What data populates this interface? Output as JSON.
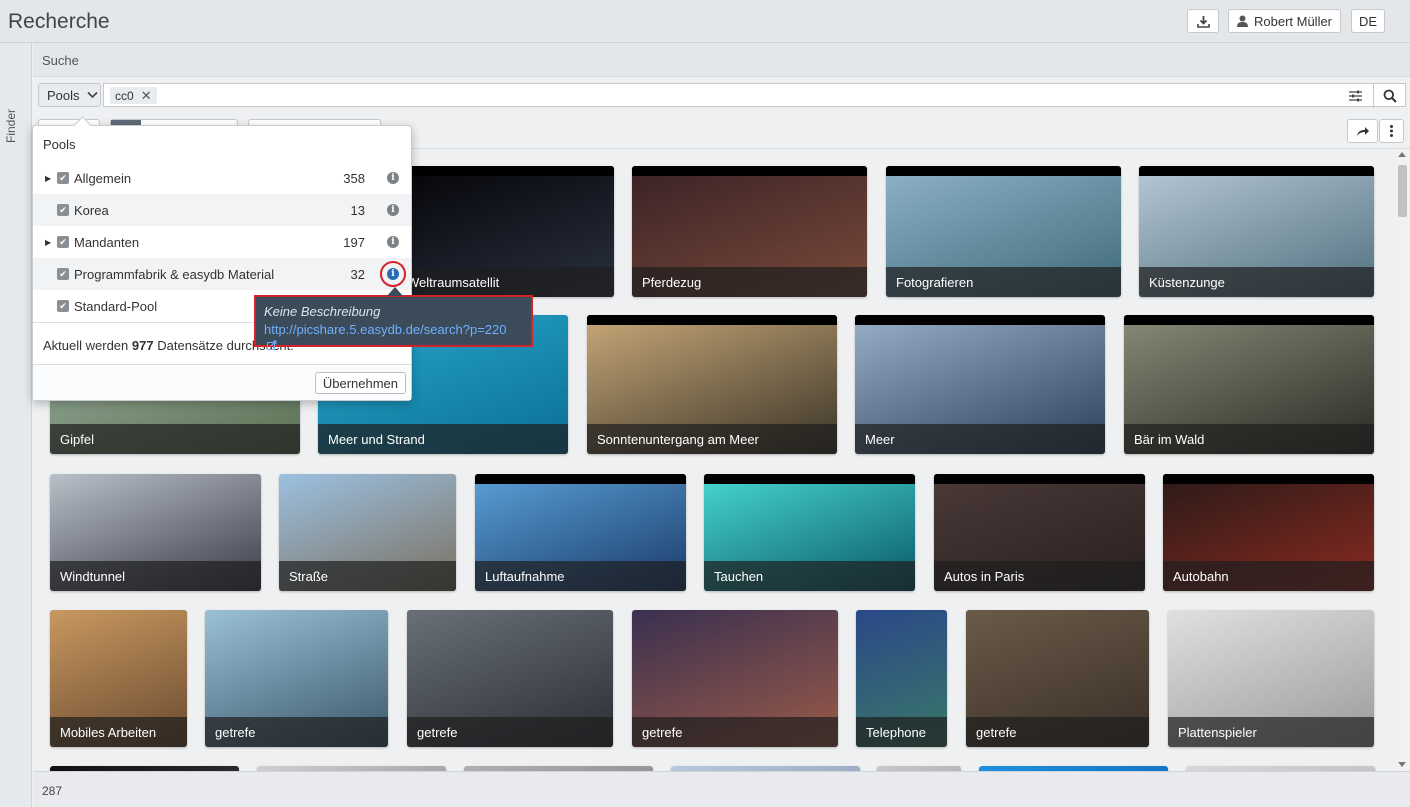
{
  "header": {
    "title": "Recherche",
    "user": "Robert Müller",
    "language": "DE"
  },
  "finder": {
    "label": "Finder"
  },
  "search": {
    "section_label": "Suche",
    "scope_label": "Pools",
    "tag": "cc0"
  },
  "pool_popover": {
    "title": "Pools",
    "pools": [
      {
        "name": "Allgemein",
        "count": "358",
        "expandable": true
      },
      {
        "name": "Korea",
        "count": "13",
        "expandable": false
      },
      {
        "name": "Mandanten",
        "count": "197",
        "expandable": true
      },
      {
        "name": "Programmfabrik & easydb Material",
        "count": "32",
        "expandable": false
      },
      {
        "name": "Standard-Pool",
        "count": "",
        "expandable": false
      }
    ],
    "summary_prefix": "Aktuell werden",
    "summary_count": "977",
    "summary_suffix": "Datensätze durchsucht.",
    "apply_label": "Übernehmen"
  },
  "tooltip": {
    "description": "Keine Beschreibung",
    "link": "http://picshare.5.easydb.de/search?p=220"
  },
  "results": {
    "tiles": [
      {
        "label": "Weltraumsatellit",
        "colors": [
          "#050508",
          "#2a3040"
        ]
      },
      {
        "label": "Pferdezug",
        "colors": [
          "#3a2226",
          "#7a4a3a"
        ]
      },
      {
        "label": "Fotografieren",
        "colors": [
          "#8fb2c8",
          "#3e6a78"
        ]
      },
      {
        "label": "Küstenzunge",
        "colors": [
          "#b8c8d6",
          "#50707e"
        ]
      },
      {
        "label": "Gipfel",
        "colors": [
          "#9fb7a8",
          "#5a6e50"
        ]
      },
      {
        "label": "Meer und Strand",
        "colors": [
          "#28a8c8",
          "#0a6e98"
        ]
      },
      {
        "label": "Sonntenuntergang am Meer",
        "colors": [
          "#c8a878",
          "#3a3428"
        ]
      },
      {
        "label": "Meer",
        "colors": [
          "#98b0c8",
          "#2a4058"
        ]
      },
      {
        "label": "Bär im Wald",
        "colors": [
          "#8a8a78",
          "#2a2a24"
        ]
      },
      {
        "label": "Windtunnel",
        "colors": [
          "#b8c0c8",
          "#3a3a48"
        ]
      },
      {
        "label": "Straße",
        "colors": [
          "#9cc0e0",
          "#7a7060"
        ]
      },
      {
        "label": "Luftaufnahme",
        "colors": [
          "#5aa0d8",
          "#1a3a68"
        ]
      },
      {
        "label": "Tauchen",
        "colors": [
          "#48d8d0",
          "#0a5868"
        ]
      },
      {
        "label": "Autos in Paris",
        "colors": [
          "#4a3a38",
          "#2a2020"
        ]
      },
      {
        "label": "Autobahn",
        "colors": [
          "#2a1a18",
          "#8a2a20"
        ]
      },
      {
        "label": "Mobiles Arbeiten",
        "colors": [
          "#c89860",
          "#6a4a30"
        ]
      },
      {
        "label": "getrefe",
        "colors": [
          "#9ac0d8",
          "#3a5868"
        ]
      },
      {
        "label": "getrefe",
        "colors": [
          "#6a7078",
          "#2a2e34"
        ]
      },
      {
        "label": "getrefe",
        "colors": [
          "#3a3050",
          "#9a5a48"
        ]
      },
      {
        "label": "Telephone",
        "colors": [
          "#2a4888",
          "#3a7868"
        ]
      },
      {
        "label": "getrefe",
        "colors": [
          "#6a5a48",
          "#3a3028"
        ]
      },
      {
        "label": "Plattenspieler",
        "colors": [
          "#e0e0e0",
          "#9a9a9a"
        ]
      },
      {
        "label": "",
        "colors": [
          "#101010",
          "#303030"
        ]
      },
      {
        "label": "",
        "colors": [
          "#d0d0d0",
          "#a0a0a0"
        ]
      },
      {
        "label": "",
        "colors": [
          "#b0b0b0",
          "#909090"
        ]
      },
      {
        "label": "",
        "colors": [
          "#b8c8e0",
          "#98a8c0"
        ]
      },
      {
        "label": "",
        "colors": [
          "#c8c8c8",
          "#b0b0b0"
        ]
      },
      {
        "label": "",
        "colors": [
          "#2090e0",
          "#1070c0"
        ]
      },
      {
        "label": "",
        "colors": [
          "#d8d8d8",
          "#c0c0c0"
        ]
      }
    ]
  },
  "footer": {
    "count": "287"
  }
}
